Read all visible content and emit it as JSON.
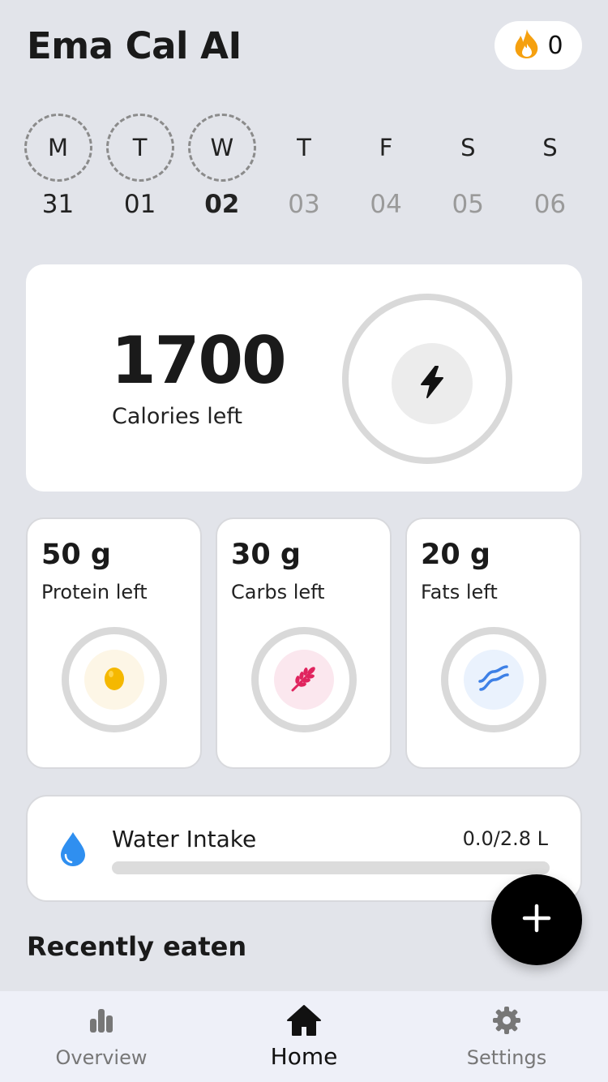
{
  "header": {
    "title": "Ema Cal AI",
    "streak": "0",
    "streak_icon": "flame-icon",
    "streak_color": "#f5a00f"
  },
  "week": [
    {
      "letter": "M",
      "date": "31",
      "state": "past"
    },
    {
      "letter": "T",
      "date": "01",
      "state": "past"
    },
    {
      "letter": "W",
      "date": "02",
      "state": "today"
    },
    {
      "letter": "T",
      "date": "03",
      "state": "future"
    },
    {
      "letter": "F",
      "date": "04",
      "state": "future"
    },
    {
      "letter": "S",
      "date": "05",
      "state": "future"
    },
    {
      "letter": "S",
      "date": "06",
      "state": "future"
    }
  ],
  "calories": {
    "value": "1700",
    "label": "Calories left",
    "icon": "lightning-icon",
    "progress": 0
  },
  "macros": [
    {
      "id": "protein",
      "value": "50 g",
      "label": "Protein left",
      "icon": "egg-icon",
      "color": "#f5b800",
      "bg": "#fdf6e6"
    },
    {
      "id": "carbs",
      "value": "30 g",
      "label": "Carbs left",
      "icon": "wheat-icon",
      "color": "#e0245e",
      "bg": "#fbe7ee"
    },
    {
      "id": "fats",
      "value": "20 g",
      "label": "Fats left",
      "icon": "bacon-icon",
      "color": "#3d80e6",
      "bg": "#eaf2fd"
    }
  ],
  "water": {
    "title": "Water Intake",
    "amount": "0.0/2.8 L",
    "progress": 0,
    "icon": "water-drop-icon",
    "color": "#2f8ff0"
  },
  "recent": {
    "title": "Recently eaten"
  },
  "fab": {
    "icon": "plus-icon"
  },
  "nav": {
    "overview": "Overview",
    "home": "Home",
    "settings": "Settings"
  }
}
